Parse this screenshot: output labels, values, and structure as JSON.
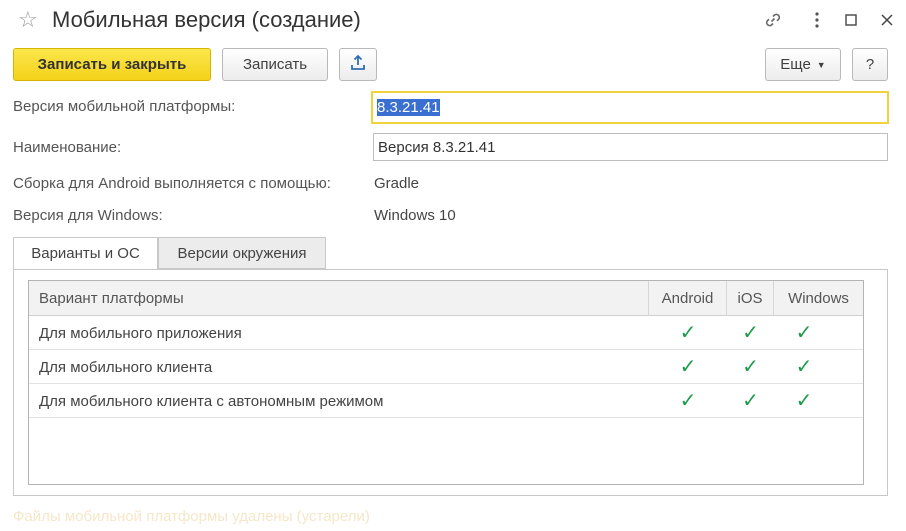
{
  "window": {
    "title": "Мобильная версия (создание)"
  },
  "toolbar": {
    "save_close_label": "Записать и закрыть",
    "save_label": "Записать",
    "more_label": "Еще",
    "help_label": "?"
  },
  "form": {
    "platform_version_label": "Версия мобильной платформы:",
    "platform_version_value": "8.3.21.41",
    "name_label": "Наименование:",
    "name_value": "Версия 8.3.21.41",
    "android_build_label": "Сборка для Android выполняется с помощью:",
    "android_build_value": "Gradle",
    "windows_version_label": "Версия для Windows:",
    "windows_version_value": "Windows 10"
  },
  "tabs": [
    {
      "label": "Варианты и ОС",
      "active": true
    },
    {
      "label": "Версии окружения",
      "active": false
    }
  ],
  "table": {
    "columns": [
      "Вариант платформы",
      "Android",
      "iOS",
      "Windows"
    ],
    "rows": [
      {
        "name": "Для мобильного приложения",
        "android": true,
        "ios": true,
        "windows": true
      },
      {
        "name": "Для мобильного клиента",
        "android": true,
        "ios": true,
        "windows": true
      },
      {
        "name": "Для мобильного клиента с автономным режимом",
        "android": true,
        "ios": true,
        "windows": true
      }
    ],
    "check_glyph": "✓"
  },
  "footer": {
    "note": "Файлы мобильной платформы удалены (устарели)"
  },
  "colors": {
    "primary_button": "#f4d21a",
    "check": "#1e9b4a",
    "focus_border": "#f2d23a",
    "selection": "#3a6fd2"
  }
}
